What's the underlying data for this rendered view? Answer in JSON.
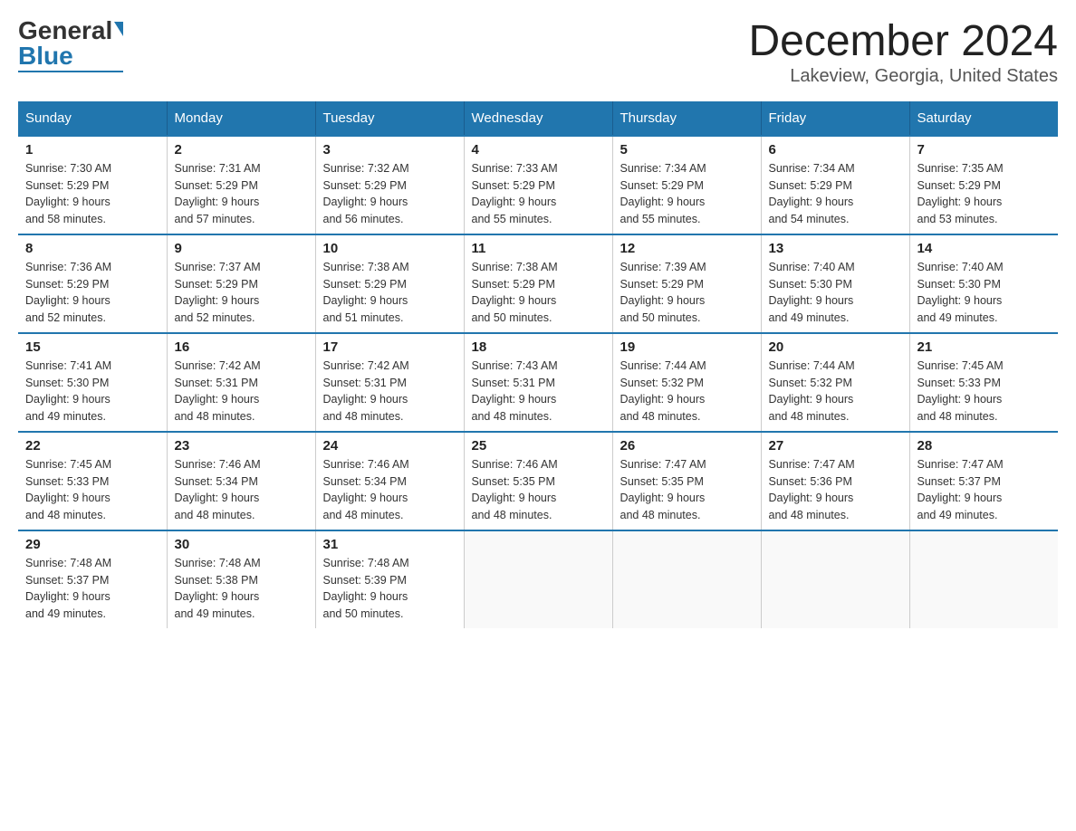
{
  "logo": {
    "general": "General",
    "blue": "Blue"
  },
  "title": "December 2024",
  "subtitle": "Lakeview, Georgia, United States",
  "days_header": [
    "Sunday",
    "Monday",
    "Tuesday",
    "Wednesday",
    "Thursday",
    "Friday",
    "Saturday"
  ],
  "weeks": [
    [
      {
        "num": "1",
        "sunrise": "7:30 AM",
        "sunset": "5:29 PM",
        "daylight": "9 hours and 58 minutes."
      },
      {
        "num": "2",
        "sunrise": "7:31 AM",
        "sunset": "5:29 PM",
        "daylight": "9 hours and 57 minutes."
      },
      {
        "num": "3",
        "sunrise": "7:32 AM",
        "sunset": "5:29 PM",
        "daylight": "9 hours and 56 minutes."
      },
      {
        "num": "4",
        "sunrise": "7:33 AM",
        "sunset": "5:29 PM",
        "daylight": "9 hours and 55 minutes."
      },
      {
        "num": "5",
        "sunrise": "7:34 AM",
        "sunset": "5:29 PM",
        "daylight": "9 hours and 55 minutes."
      },
      {
        "num": "6",
        "sunrise": "7:34 AM",
        "sunset": "5:29 PM",
        "daylight": "9 hours and 54 minutes."
      },
      {
        "num": "7",
        "sunrise": "7:35 AM",
        "sunset": "5:29 PM",
        "daylight": "9 hours and 53 minutes."
      }
    ],
    [
      {
        "num": "8",
        "sunrise": "7:36 AM",
        "sunset": "5:29 PM",
        "daylight": "9 hours and 52 minutes."
      },
      {
        "num": "9",
        "sunrise": "7:37 AM",
        "sunset": "5:29 PM",
        "daylight": "9 hours and 52 minutes."
      },
      {
        "num": "10",
        "sunrise": "7:38 AM",
        "sunset": "5:29 PM",
        "daylight": "9 hours and 51 minutes."
      },
      {
        "num": "11",
        "sunrise": "7:38 AM",
        "sunset": "5:29 PM",
        "daylight": "9 hours and 50 minutes."
      },
      {
        "num": "12",
        "sunrise": "7:39 AM",
        "sunset": "5:29 PM",
        "daylight": "9 hours and 50 minutes."
      },
      {
        "num": "13",
        "sunrise": "7:40 AM",
        "sunset": "5:30 PM",
        "daylight": "9 hours and 49 minutes."
      },
      {
        "num": "14",
        "sunrise": "7:40 AM",
        "sunset": "5:30 PM",
        "daylight": "9 hours and 49 minutes."
      }
    ],
    [
      {
        "num": "15",
        "sunrise": "7:41 AM",
        "sunset": "5:30 PM",
        "daylight": "9 hours and 49 minutes."
      },
      {
        "num": "16",
        "sunrise": "7:42 AM",
        "sunset": "5:31 PM",
        "daylight": "9 hours and 48 minutes."
      },
      {
        "num": "17",
        "sunrise": "7:42 AM",
        "sunset": "5:31 PM",
        "daylight": "9 hours and 48 minutes."
      },
      {
        "num": "18",
        "sunrise": "7:43 AM",
        "sunset": "5:31 PM",
        "daylight": "9 hours and 48 minutes."
      },
      {
        "num": "19",
        "sunrise": "7:44 AM",
        "sunset": "5:32 PM",
        "daylight": "9 hours and 48 minutes."
      },
      {
        "num": "20",
        "sunrise": "7:44 AM",
        "sunset": "5:32 PM",
        "daylight": "9 hours and 48 minutes."
      },
      {
        "num": "21",
        "sunrise": "7:45 AM",
        "sunset": "5:33 PM",
        "daylight": "9 hours and 48 minutes."
      }
    ],
    [
      {
        "num": "22",
        "sunrise": "7:45 AM",
        "sunset": "5:33 PM",
        "daylight": "9 hours and 48 minutes."
      },
      {
        "num": "23",
        "sunrise": "7:46 AM",
        "sunset": "5:34 PM",
        "daylight": "9 hours and 48 minutes."
      },
      {
        "num": "24",
        "sunrise": "7:46 AM",
        "sunset": "5:34 PM",
        "daylight": "9 hours and 48 minutes."
      },
      {
        "num": "25",
        "sunrise": "7:46 AM",
        "sunset": "5:35 PM",
        "daylight": "9 hours and 48 minutes."
      },
      {
        "num": "26",
        "sunrise": "7:47 AM",
        "sunset": "5:35 PM",
        "daylight": "9 hours and 48 minutes."
      },
      {
        "num": "27",
        "sunrise": "7:47 AM",
        "sunset": "5:36 PM",
        "daylight": "9 hours and 48 minutes."
      },
      {
        "num": "28",
        "sunrise": "7:47 AM",
        "sunset": "5:37 PM",
        "daylight": "9 hours and 49 minutes."
      }
    ],
    [
      {
        "num": "29",
        "sunrise": "7:48 AM",
        "sunset": "5:37 PM",
        "daylight": "9 hours and 49 minutes."
      },
      {
        "num": "30",
        "sunrise": "7:48 AM",
        "sunset": "5:38 PM",
        "daylight": "9 hours and 49 minutes."
      },
      {
        "num": "31",
        "sunrise": "7:48 AM",
        "sunset": "5:39 PM",
        "daylight": "9 hours and 50 minutes."
      },
      null,
      null,
      null,
      null
    ]
  ]
}
